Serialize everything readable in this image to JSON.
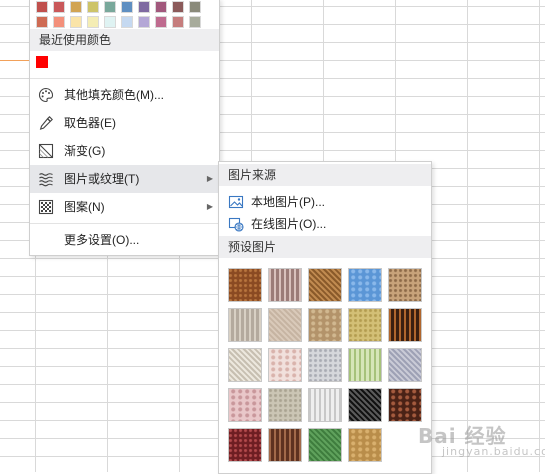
{
  "palette": {
    "row1": [
      "#c0504d",
      "#c9585a",
      "#d1a454",
      "#cdc469",
      "#79a89b",
      "#5f8fc1",
      "#7f6aa1",
      "#a1587c",
      "#8b5a5a",
      "#8a8a7a"
    ],
    "row2": [
      "#ce6b54",
      "#f3907b",
      "#fae4a8",
      "#f4edb4",
      "#dff3f3",
      "#c5d9f1",
      "#b4a7d6",
      "#bf6b8f",
      "#c57d7d",
      "#a7ab9b"
    ]
  },
  "recent": {
    "label": "最近使用颜色",
    "colors": [
      "#ff0000"
    ]
  },
  "menu": {
    "more_colors": "其他填充颜色(M)...",
    "eyedropper": "取色器(E)",
    "gradient": "渐变(G)",
    "picture_texture": "图片或纹理(T)",
    "pattern": "图案(N)",
    "more_settings": "更多设置(O)...",
    "submenu_arrow": "▶"
  },
  "texture_menu": {
    "source_label": "图片来源",
    "local_picture": "本地图片(P)...",
    "online_picture": "在线图片(O)...",
    "preset_label": "预设图片",
    "presets": [
      {
        "name": "brown-cork",
        "color": "#8a4a22",
        "accent": "#b8753e"
      },
      {
        "name": "granite-pink",
        "color": "#9b7b78",
        "accent": "#d8c0bc"
      },
      {
        "name": "woven-mat",
        "color": "#c08a50",
        "accent": "#8a5a2a"
      },
      {
        "name": "water-blue",
        "color": "#5b96d6",
        "accent": "#8ab8ea"
      },
      {
        "name": "sand-speckle",
        "color": "#c8a37a",
        "accent": "#8d6a48"
      },
      {
        "name": "gray-granite",
        "color": "#b4aa9e",
        "accent": "#d8d0c4"
      },
      {
        "name": "pale-wood",
        "color": "#d9c9b9",
        "accent": "#c6b4a2"
      },
      {
        "name": "recycled-paper",
        "color": "#b3936a",
        "accent": "#d1b890"
      },
      {
        "name": "gold-sand",
        "color": "#d3bf76",
        "accent": "#b39c50"
      },
      {
        "name": "leopard-dots",
        "color": "#3a1f10",
        "accent": "#b0662d"
      },
      {
        "name": "white-marble",
        "color": "#ece7dd",
        "accent": "#c7bfb1"
      },
      {
        "name": "pink-stripes",
        "color": "#f1e0dc",
        "accent": "#d9b3ac"
      },
      {
        "name": "gray-stripes",
        "color": "#d6d7db",
        "accent": "#a9abb3"
      },
      {
        "name": "green-check",
        "color": "#d6e6b8",
        "accent": "#a6c27a"
      },
      {
        "name": "blue-weave",
        "color": "#c9cad6",
        "accent": "#9ea1b5"
      },
      {
        "name": "pink-plaid",
        "color": "#e9c7c9",
        "accent": "#c9979b"
      },
      {
        "name": "beige-fabric",
        "color": "#cbc5b4",
        "accent": "#aaa391"
      },
      {
        "name": "white-speckle",
        "color": "#efefef",
        "accent": "#c8c8c8"
      },
      {
        "name": "black-speckle",
        "color": "#111111",
        "accent": "#5a5a5a"
      },
      {
        "name": "dark-floral",
        "color": "#4a2216",
        "accent": "#a45a3e"
      },
      {
        "name": "maroon-floral",
        "color": "#6e1e22",
        "accent": "#b44b4d"
      },
      {
        "name": "brown-granite",
        "color": "#5e3220",
        "accent": "#a26a4a"
      },
      {
        "name": "green-felt",
        "color": "#3f7d3e",
        "accent": "#5fa15c"
      },
      {
        "name": "tan-weave",
        "color": "#b98d4a",
        "accent": "#d9b06e"
      }
    ]
  },
  "watermark": {
    "main": "Bai 经验",
    "sub": "jingyan.baidu.com"
  },
  "colors": {
    "recent_red": "#ff0000",
    "hover_row": "#e6e7ea",
    "section_head": "#eeeef0"
  }
}
